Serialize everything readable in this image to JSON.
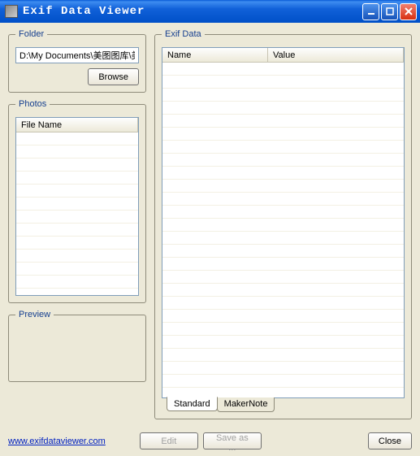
{
  "window": {
    "title": "Exif Data Viewer"
  },
  "folder": {
    "legend": "Folder",
    "path": "D:\\My Documents\\美图图库\\美",
    "browse": "Browse"
  },
  "photos": {
    "legend": "Photos",
    "col_filename": "File Name"
  },
  "preview": {
    "legend": "Preview"
  },
  "exif": {
    "legend": "Exif Data",
    "col_name": "Name",
    "col_value": "Value",
    "tab_standard": "Standard",
    "tab_makernote": "MakerNote"
  },
  "buttons": {
    "edit": "Edit",
    "saveas": "Save as ...",
    "close": "Close"
  },
  "link": {
    "url_text": "www.exifdataviewer.com"
  }
}
